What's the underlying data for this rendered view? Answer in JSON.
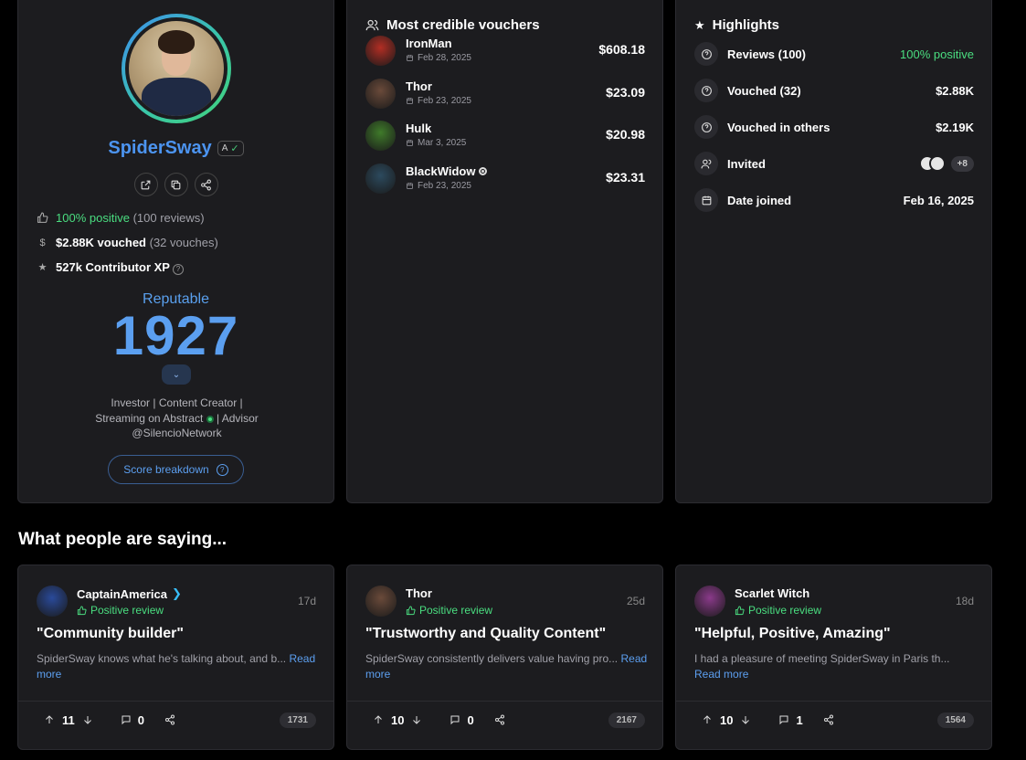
{
  "profile": {
    "username": "SpiderSway",
    "level_badge": "A",
    "positive_pct": "100% positive",
    "reviews_count": "(100 reviews)",
    "vouched_amount": "$2.88K vouched",
    "vouches_count": "(32 vouches)",
    "xp": "527k Contributor XP",
    "reputation_label": "Reputable",
    "reputation_score": "1927",
    "bio_line1": "Investor | Content Creator |",
    "bio_line2a": "Streaming on Abstract",
    "bio_line2b": "| Advisor",
    "bio_line3": "@SilencioNetwork",
    "score_breakdown_label": "Score breakdown",
    "dollar_icon": "$",
    "star_icon": "★",
    "question_mark": "?",
    "colors": {
      "accent": "#4c94f0",
      "positive": "#4ade80"
    }
  },
  "vouchers": {
    "title": "Most credible vouchers",
    "items": [
      {
        "name": "IronMan",
        "date": "Feb 28, 2025",
        "amount": "$608.18",
        "color": "#b22e24"
      },
      {
        "name": "Thor",
        "date": "Feb 23, 2025",
        "amount": "$23.09",
        "color": "#6a4a3a"
      },
      {
        "name": "Hulk",
        "date": "Mar 3, 2025",
        "amount": "$20.98",
        "color": "#3f7a2a"
      },
      {
        "name": "BlackWidow",
        "date": "Feb 23, 2025",
        "amount": "$23.31",
        "color": "#2c4a5e"
      }
    ]
  },
  "highlights": {
    "title": "Highlights",
    "star_icon": "★",
    "reviews_label": "Reviews (100)",
    "reviews_value": "100% positive",
    "vouched_label": "Vouched (32)",
    "vouched_value": "$2.88K",
    "vouched_others_label": "Vouched in others",
    "vouched_others_value": "$2.19K",
    "invited_label": "Invited",
    "invited_more": "+8",
    "date_joined_label": "Date joined",
    "date_joined_value": "Feb 16, 2025"
  },
  "section": {
    "title": "What people are saying..."
  },
  "reviews": [
    {
      "author": "CaptainAmerica",
      "type": "Positive review",
      "age": "17d",
      "title": "\"Community builder\"",
      "body": "SpiderSway knows what he's talking about, and b...",
      "more": "Read more",
      "upvotes": "11",
      "comments": "0",
      "count": "1731",
      "color": "#2a4a9a"
    },
    {
      "author": "Thor",
      "type": "Positive review",
      "age": "25d",
      "title": "\"Trustworthy and Quality Content\"",
      "body": "SpiderSway consistently delivers value having pro...",
      "more": "Read more",
      "upvotes": "10",
      "comments": "0",
      "count": "2167",
      "color": "#6a4a3a"
    },
    {
      "author": "Scarlet Witch",
      "type": "Positive review",
      "age": "18d",
      "title": "\"Helpful, Positive, Amazing\"",
      "body": "I had a pleasure of meeting SpiderSway in Paris th...",
      "more": "Read more",
      "upvotes": "10",
      "comments": "1",
      "count": "1564",
      "color": "#8a3a8a"
    }
  ]
}
